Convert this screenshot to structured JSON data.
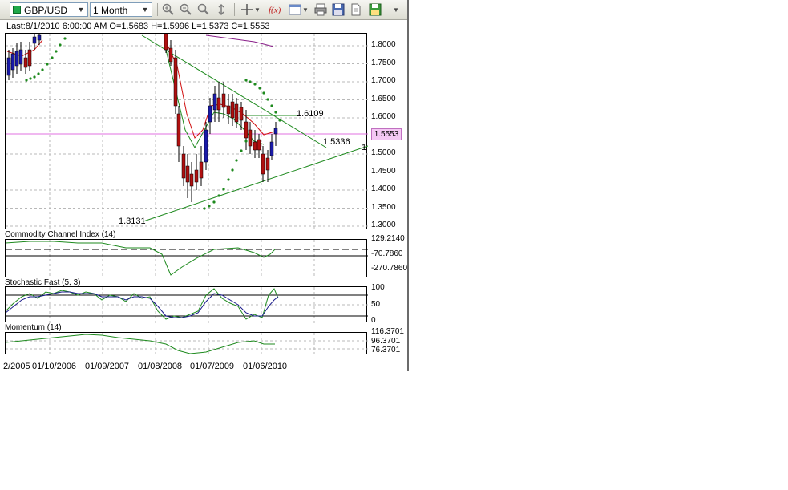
{
  "toolbar": {
    "symbol": "GBP/USD",
    "period": "1 Month"
  },
  "info": {
    "last_line": "Last:8/1/2010 6:00:00 AM O=1.5683 H=1.5996 L=1.5373 C=1.5553"
  },
  "price_panel": {
    "current_price": "1.5553",
    "axis_labels": [
      "1.8000",
      "1.7500",
      "1.7000",
      "1.6500",
      "1.6000",
      "1.5500",
      "1.5000",
      "1.4500",
      "1.4000",
      "1.3500",
      "1.3000"
    ],
    "annotations": {
      "upper_right": "1.6109",
      "trend_upper": "1.5336",
      "support_start": "1.3131",
      "edge_1": "1",
      "mid_label": "1.6109"
    },
    "colors": {
      "up_candle": "#1a1aa8",
      "down_candle": "#b01010",
      "trend": "#1e8a1e",
      "sar": "#1e8a1e",
      "ma_red": "#d01010",
      "ma_purple": "#8a208a",
      "price_line": "#e070e0"
    }
  },
  "cci_panel": {
    "title": "Commodity Channel Index (14)",
    "axis_labels": [
      "129.2140",
      "-70.7860",
      "-270.7860"
    ]
  },
  "stoch_panel": {
    "title": "Stochastic Fast (5, 3)",
    "axis_labels": [
      "100",
      "50",
      "0"
    ]
  },
  "momentum_panel": {
    "title": "Momentum (14)",
    "axis_labels": [
      "116.3701",
      "96.3701",
      "76.3701"
    ]
  },
  "dates": [
    "2/2005",
    "01/10/2006",
    "01/09/2007",
    "01/08/2008",
    "01/07/2009",
    "01/06/2010"
  ]
}
